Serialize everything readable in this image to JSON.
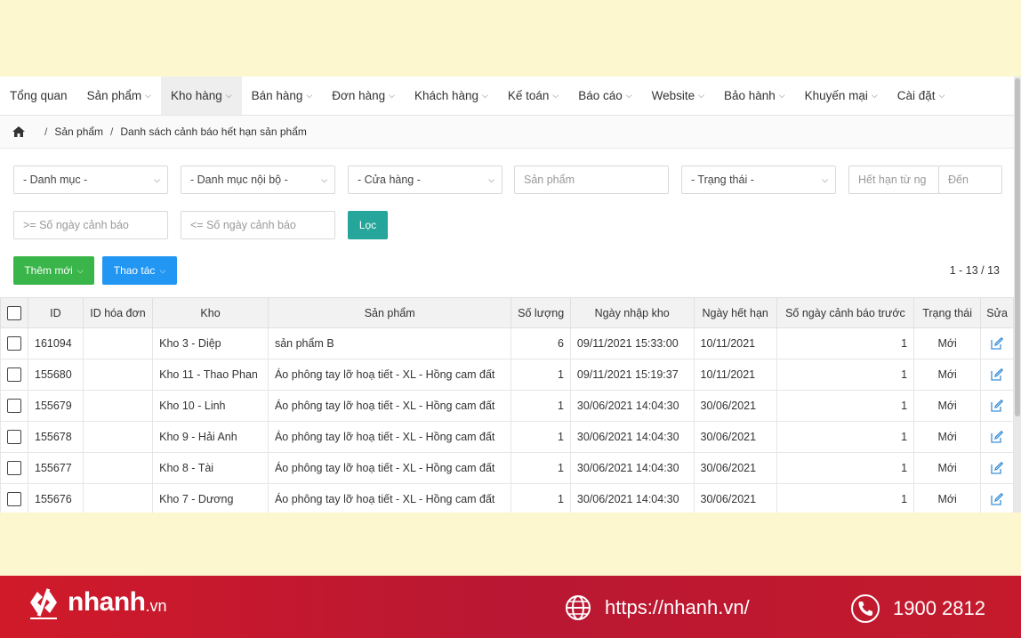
{
  "nav": {
    "items": [
      {
        "label": "Tổng quan",
        "chevron": false
      },
      {
        "label": "Sản phẩm",
        "chevron": true
      },
      {
        "label": "Kho hàng",
        "chevron": true,
        "active": true
      },
      {
        "label": "Bán hàng",
        "chevron": true
      },
      {
        "label": "Đơn hàng",
        "chevron": true
      },
      {
        "label": "Khách hàng",
        "chevron": true
      },
      {
        "label": "Kế toán",
        "chevron": true
      },
      {
        "label": "Báo cáo",
        "chevron": true
      },
      {
        "label": "Website",
        "chevron": true
      },
      {
        "label": "Bảo hành",
        "chevron": true
      },
      {
        "label": "Khuyến mại",
        "chevron": true
      },
      {
        "label": "Cài đặt",
        "chevron": true
      }
    ]
  },
  "breadcrumb": {
    "icon": "home-icon",
    "items": [
      "Sản phẩm",
      "Danh sách cảnh báo hết hạn sản phẩm"
    ]
  },
  "filters": {
    "category": "- Danh mục -",
    "internal_category": "- Danh mục nội bộ -",
    "store": "- Cửa hàng -",
    "product_placeholder": "Sản phẩm",
    "status": "- Trạng thái -",
    "expiry_from_placeholder": "Hết hạn từ ng",
    "expiry_to_placeholder": "Đến",
    "days_min_placeholder": ">= Số ngày cảnh báo",
    "days_max_placeholder": "<= Số ngày cảnh báo",
    "filter_button": "Lọc"
  },
  "actions": {
    "add_new": "Thêm mới",
    "operations": "Thao tác",
    "pagination": "1 - 13 / 13"
  },
  "table": {
    "headers": [
      "ID",
      "ID hóa đơn",
      "Kho",
      "Sản phẩm",
      "Số lượng",
      "Ngày nhập kho",
      "Ngày hết hạn",
      "Số ngày cảnh báo trước",
      "Trạng thái",
      "Sửa"
    ],
    "rows": [
      {
        "id": "161094",
        "invoice": "",
        "warehouse": "Kho 3 - Diệp",
        "product": "sản phẩm B",
        "qty": "6",
        "import_date": "09/11/2021 15:33:00",
        "expiry": "10/11/2021",
        "warn_days": "1",
        "status": "Mới"
      },
      {
        "id": "155680",
        "invoice": "",
        "warehouse": "Kho 11 - Thao Phan",
        "product": "Áo phông tay lỡ hoạ tiết - XL - Hồng cam đất",
        "qty": "1",
        "import_date": "09/11/2021 15:19:37",
        "expiry": "10/11/2021",
        "warn_days": "1",
        "status": "Mới"
      },
      {
        "id": "155679",
        "invoice": "",
        "warehouse": "Kho 10 - Linh",
        "product": "Áo phông tay lỡ hoạ tiết - XL - Hồng cam đất",
        "qty": "1",
        "import_date": "30/06/2021 14:04:30",
        "expiry": "30/06/2021",
        "warn_days": "1",
        "status": "Mới"
      },
      {
        "id": "155678",
        "invoice": "",
        "warehouse": "Kho 9 - Hải Anh",
        "product": "Áo phông tay lỡ hoạ tiết - XL - Hồng cam đất",
        "qty": "1",
        "import_date": "30/06/2021 14:04:30",
        "expiry": "30/06/2021",
        "warn_days": "1",
        "status": "Mới"
      },
      {
        "id": "155677",
        "invoice": "",
        "warehouse": "Kho 8 - Tài",
        "product": "Áo phông tay lỡ hoạ tiết - XL - Hồng cam đất",
        "qty": "1",
        "import_date": "30/06/2021 14:04:30",
        "expiry": "30/06/2021",
        "warn_days": "1",
        "status": "Mới"
      },
      {
        "id": "155676",
        "invoice": "",
        "warehouse": "Kho 7 - Dương",
        "product": "Áo phông tay lỡ hoạ tiết - XL - Hồng cam đất",
        "qty": "1",
        "import_date": "30/06/2021 14:04:30",
        "expiry": "30/06/2021",
        "warn_days": "1",
        "status": "Mới"
      }
    ]
  },
  "footer": {
    "brand": "nhanh",
    "brand_tld": ".vn",
    "website": "https://nhanh.vn/",
    "phone": "1900 2812"
  },
  "colors": {
    "filter_button": "#26a69a",
    "add_button": "#3ab54a",
    "operations_button": "#2196f3",
    "footer": "#c41a2c",
    "background": "#fdf7d0",
    "edit_icon": "#3b8fd9"
  }
}
